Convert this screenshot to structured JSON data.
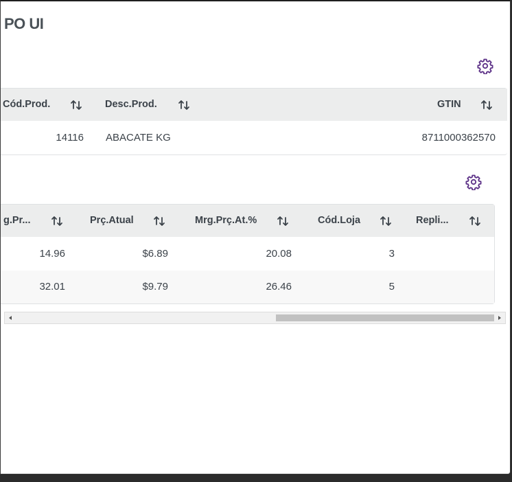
{
  "app": {
    "title": "PO UI"
  },
  "colors": {
    "accent": "#5b2f86",
    "header_bg": "#eceded"
  },
  "icons": {
    "settings": "gear-icon",
    "sort": "sort-arrows-icon"
  },
  "table1": {
    "columns": [
      {
        "label": "Cód.Prod."
      },
      {
        "label": "Desc.Prod."
      },
      {
        "label": "GTIN"
      }
    ],
    "rows": [
      {
        "cod_prod": "14116",
        "desc_prod": "ABACATE KG",
        "gtin": "8711000362570"
      }
    ]
  },
  "table2": {
    "columns": [
      {
        "label": "g.Pr..."
      },
      {
        "label": "Prç.Atual"
      },
      {
        "label": "Mrg.Prç.At.%"
      },
      {
        "label": "Cód.Loja"
      },
      {
        "label": "Repli..."
      }
    ],
    "rows": [
      {
        "mrg_pr": "14.96",
        "prc_atual": "$6.89",
        "mrg_prc_at": "20.08",
        "cod_loja": "3",
        "repli": ""
      },
      {
        "mrg_pr": "32.01",
        "prc_atual": "$9.79",
        "mrg_prc_at": "26.46",
        "cod_loja": "5",
        "repli": ""
      }
    ]
  },
  "scrollbar": {
    "thumb_position_fraction": 0.55
  }
}
